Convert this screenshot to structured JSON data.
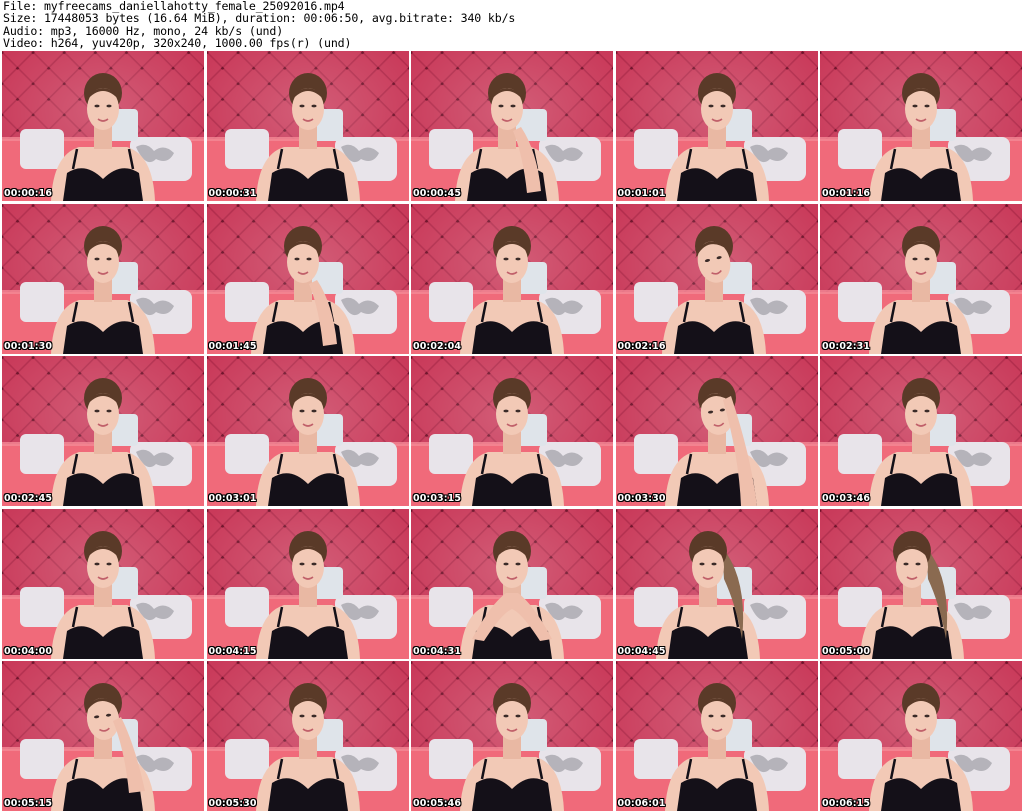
{
  "header": {
    "file": "File: myfreecams_daniellahotty_female_25092016.mp4",
    "size": "Size: 17448053 bytes (16.64 MiB), duration: 00:06:50, avg.bitrate: 340 kb/s",
    "audio": "Audio: mp3, 16000 Hz, mono, 24 kb/s (und)",
    "video": "Video: h264, yuv420p, 320x240, 1000.00 fps(r) (und)"
  },
  "colors": {
    "backdrop": "#c93a5a",
    "backdrop_dark": "#9e2040",
    "couch": "#f06a7a",
    "pillow": "#e8e4ea",
    "skin": "#f2c9b6",
    "hair": "#5a3a28",
    "top": "#141018"
  },
  "thumbnails": [
    {
      "time": "00:00:16",
      "pose": "center"
    },
    {
      "time": "00:00:31",
      "pose": "center"
    },
    {
      "time": "00:00:45",
      "pose": "hand-chin"
    },
    {
      "time": "00:01:01",
      "pose": "center"
    },
    {
      "time": "00:01:16",
      "pose": "center"
    },
    {
      "time": "00:01:30",
      "pose": "center"
    },
    {
      "time": "00:01:45",
      "pose": "hand-chin"
    },
    {
      "time": "00:02:04",
      "pose": "center"
    },
    {
      "time": "00:02:16",
      "pose": "tilt"
    },
    {
      "time": "00:02:31",
      "pose": "center"
    },
    {
      "time": "00:02:45",
      "pose": "center"
    },
    {
      "time": "00:03:01",
      "pose": "center"
    },
    {
      "time": "00:03:15",
      "pose": "center"
    },
    {
      "time": "00:03:30",
      "pose": "hand-head"
    },
    {
      "time": "00:03:46",
      "pose": "center"
    },
    {
      "time": "00:04:00",
      "pose": "center"
    },
    {
      "time": "00:04:15",
      "pose": "center"
    },
    {
      "time": "00:04:31",
      "pose": "hands-clasped"
    },
    {
      "time": "00:04:45",
      "pose": "side"
    },
    {
      "time": "00:05:00",
      "pose": "side"
    },
    {
      "time": "00:05:15",
      "pose": "hand-ear"
    },
    {
      "time": "00:05:30",
      "pose": "center"
    },
    {
      "time": "00:05:46",
      "pose": "center"
    },
    {
      "time": "00:06:01",
      "pose": "center"
    },
    {
      "time": "00:06:15",
      "pose": "center"
    }
  ]
}
